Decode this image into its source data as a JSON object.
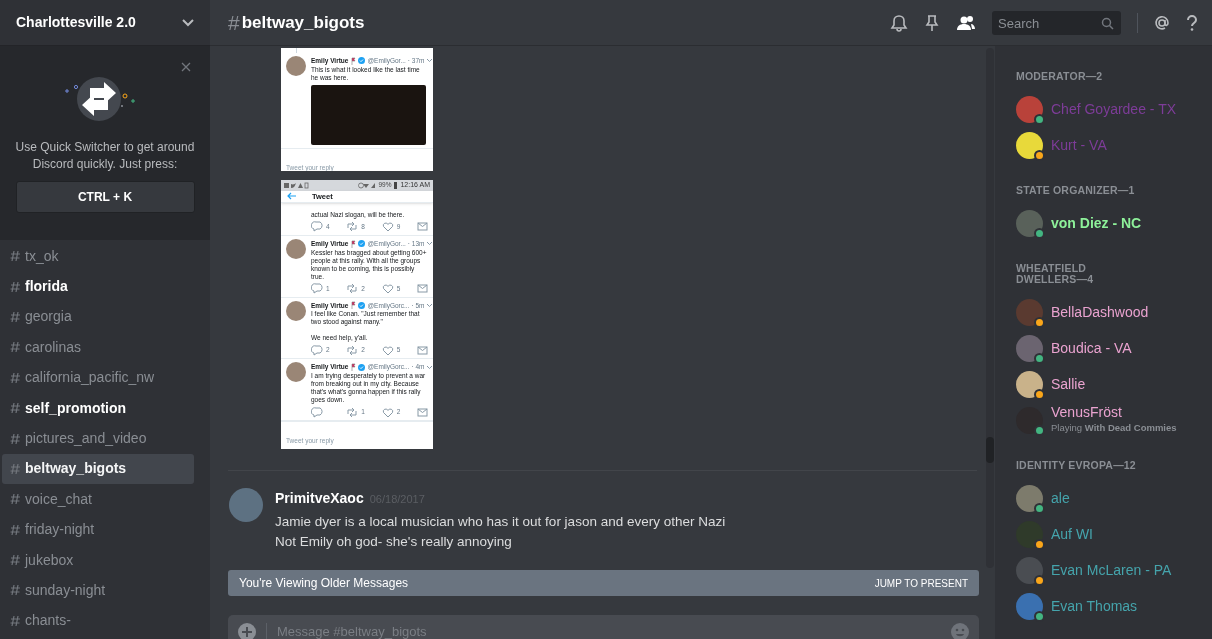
{
  "server": {
    "name": "Charlottesville 2.0"
  },
  "quick_switcher": {
    "text": "Use Quick Switcher to get around Discord quickly. Just press:",
    "shortcut": "CTRL + K"
  },
  "channels": [
    {
      "name": "tx_ok",
      "unread": false,
      "selected": false
    },
    {
      "name": "florida",
      "unread": true,
      "selected": false
    },
    {
      "name": "georgia",
      "unread": false,
      "selected": false
    },
    {
      "name": "carolinas",
      "unread": false,
      "selected": false
    },
    {
      "name": "california_pacific_nw",
      "unread": false,
      "selected": false
    },
    {
      "name": "self_promotion",
      "unread": true,
      "selected": false
    },
    {
      "name": "pictures_and_video",
      "unread": false,
      "selected": false
    },
    {
      "name": "beltway_bigots",
      "unread": false,
      "selected": true
    },
    {
      "name": "voice_chat",
      "unread": false,
      "selected": false
    },
    {
      "name": "friday-night",
      "unread": false,
      "selected": false
    },
    {
      "name": "jukebox",
      "unread": false,
      "selected": false
    },
    {
      "name": "sunday-night",
      "unread": false,
      "selected": false
    },
    {
      "name": "chants-",
      "unread": false,
      "selected": false
    }
  ],
  "header": {
    "hash": "#",
    "channel": "beltway_bigots",
    "search_placeholder": "Search"
  },
  "attachments": [
    {
      "kind": "thread",
      "tweets": [
        {
          "kind": "full",
          "author": "Emily Virtue",
          "handle": "@EmilyGor...",
          "time": "· 37m",
          "text": [
            "This is what it looked like the last time he was here."
          ],
          "photo": true
        }
      ],
      "reply_prompt": "Tweet your reply"
    },
    {
      "kind": "phone",
      "status_time": "12:16 AM",
      "battery": "99%",
      "title": "Tweet",
      "tweets": [
        {
          "kind": "partial",
          "text": [
            "actual Nazi slogan, will be there."
          ],
          "counts": {
            "reply": "4",
            "retweet": "8",
            "like": "9"
          }
        },
        {
          "kind": "full",
          "author": "Emily Virtue",
          "handle": "@EmilyGor...",
          "time": "· 13m",
          "text": [
            "Kessler has bragged about getting 600+ people at this rally. With all the groups known to be coming, this is possibly true."
          ],
          "counts": {
            "reply": "1",
            "retweet": "2",
            "like": "5"
          }
        },
        {
          "kind": "full",
          "author": "Emily Virtue",
          "handle": "@EmilyGorc...",
          "time": "· 5m",
          "text": [
            "I feel like Conan. \"Just remember that two stood against many.\"",
            "We need help, y'all."
          ],
          "counts": {
            "reply": "2",
            "retweet": "2",
            "like": "5"
          }
        },
        {
          "kind": "full",
          "author": "Emily Virtue",
          "handle": "@EmilyGorc...",
          "time": "· 4m",
          "text": [
            "I am trying desperately to prevent a war from breaking out in my city. Because that's what's gonna happen if this rally goes down."
          ],
          "counts": {
            "retweet": "1",
            "like": "2"
          }
        }
      ],
      "reply_prompt": "Tweet your reply"
    }
  ],
  "message": {
    "author": "PrimitveXaoc",
    "timestamp": "06/18/2017",
    "lines": [
      "Jamie dyer is a local musician who has it out for jason and every other Nazi",
      "Not Emily oh god- she's really annoying"
    ]
  },
  "older_bar": {
    "text": "You're Viewing Older Messages",
    "action": "JUMP TO PRESENT"
  },
  "composer": {
    "placeholder": "Message #beltway_bigots"
  },
  "member_groups": [
    {
      "title": "MODERATOR—2",
      "color": "#7d3c98",
      "members": [
        {
          "name": "Chef Goyardee - TX",
          "idle": false
        },
        {
          "name": "Kurt - VA",
          "idle": true
        }
      ]
    },
    {
      "title": "STATE ORGANIZER—1",
      "color": "#8ef19a",
      "members": [
        {
          "name": "von Diez - NC",
          "idle": false
        }
      ]
    },
    {
      "title": "WHEATFIELD DWELLERS—4",
      "color": "#eaa3d0",
      "members": [
        {
          "name": "BellaDashwood",
          "idle": true
        },
        {
          "name": "Boudica - VA",
          "idle": false
        },
        {
          "name": "Sallie",
          "idle": true
        },
        {
          "name": "VenusFröst",
          "idle": false,
          "activity": "Playing **With Dead Commies**"
        }
      ]
    },
    {
      "title": "IDENTITY EVROPA—12",
      "color": "#45a4ac",
      "members": [
        {
          "name": "ale",
          "idle": false
        },
        {
          "name": "Auf WI",
          "idle": true
        },
        {
          "name": "Evan McLaren - PA",
          "idle": true
        },
        {
          "name": "Evan Thomas",
          "idle": false
        }
      ]
    }
  ]
}
